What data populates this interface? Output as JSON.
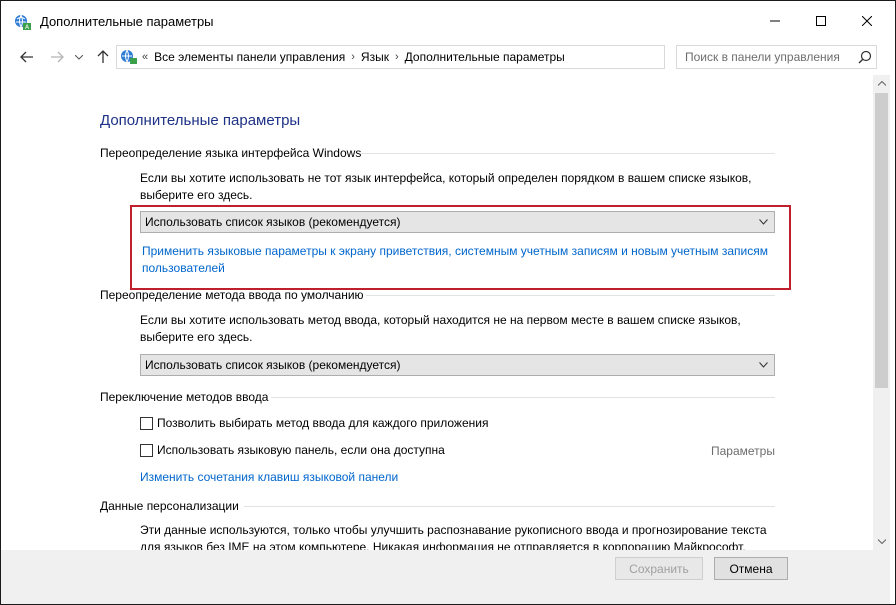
{
  "window": {
    "title": "Дополнительные параметры"
  },
  "address": {
    "lead": "«",
    "crumbs": [
      "Все элементы панели управления",
      "Язык",
      "Дополнительные параметры"
    ]
  },
  "search": {
    "placeholder": "Поиск в панели управления"
  },
  "main": {
    "title": "Дополнительные параметры",
    "display_language": {
      "heading": "Переопределение языка интерфейса Windows",
      "description": "Если вы хотите использовать не тот язык интерфейса, который определен порядком в вашем списке языков, выберите его здесь.",
      "select_value": "Использовать список языков (рекомендуется)",
      "apply_link": "Применить языковые параметры к экрану приветствия, системным учетным записям и новым учетным записям пользователей"
    },
    "input_method": {
      "heading": "Переопределение метода ввода по умолчанию",
      "description": "Если вы хотите использовать метод ввода, который находится не на первом месте в вашем списке языков, выберите его здесь.",
      "select_value": "Использовать список языков (рекомендуется)"
    },
    "switching": {
      "heading": "Переключение методов ввода",
      "option1": "Позволить выбирать метод ввода для каждого приложения",
      "option2": "Использовать языковую панель, если она доступна",
      "options_link": "Параметры",
      "hotkeys_link": "Изменить сочетания клавиш языковой панели"
    },
    "personalization": {
      "heading": "Данные персонализации",
      "description": "Эти данные используются, только чтобы улучшить распознавание рукописного ввода и прогнозирование текста для языков без IME на этом компьютере. Никакая информация не отправляется в корпорацию Майкрософт."
    }
  },
  "footer": {
    "save": "Сохранить",
    "cancel": "Отмена"
  },
  "colors": {
    "title_blue": "#1e3287",
    "link_blue": "#0066cc",
    "highlight_red": "#c0202b"
  }
}
